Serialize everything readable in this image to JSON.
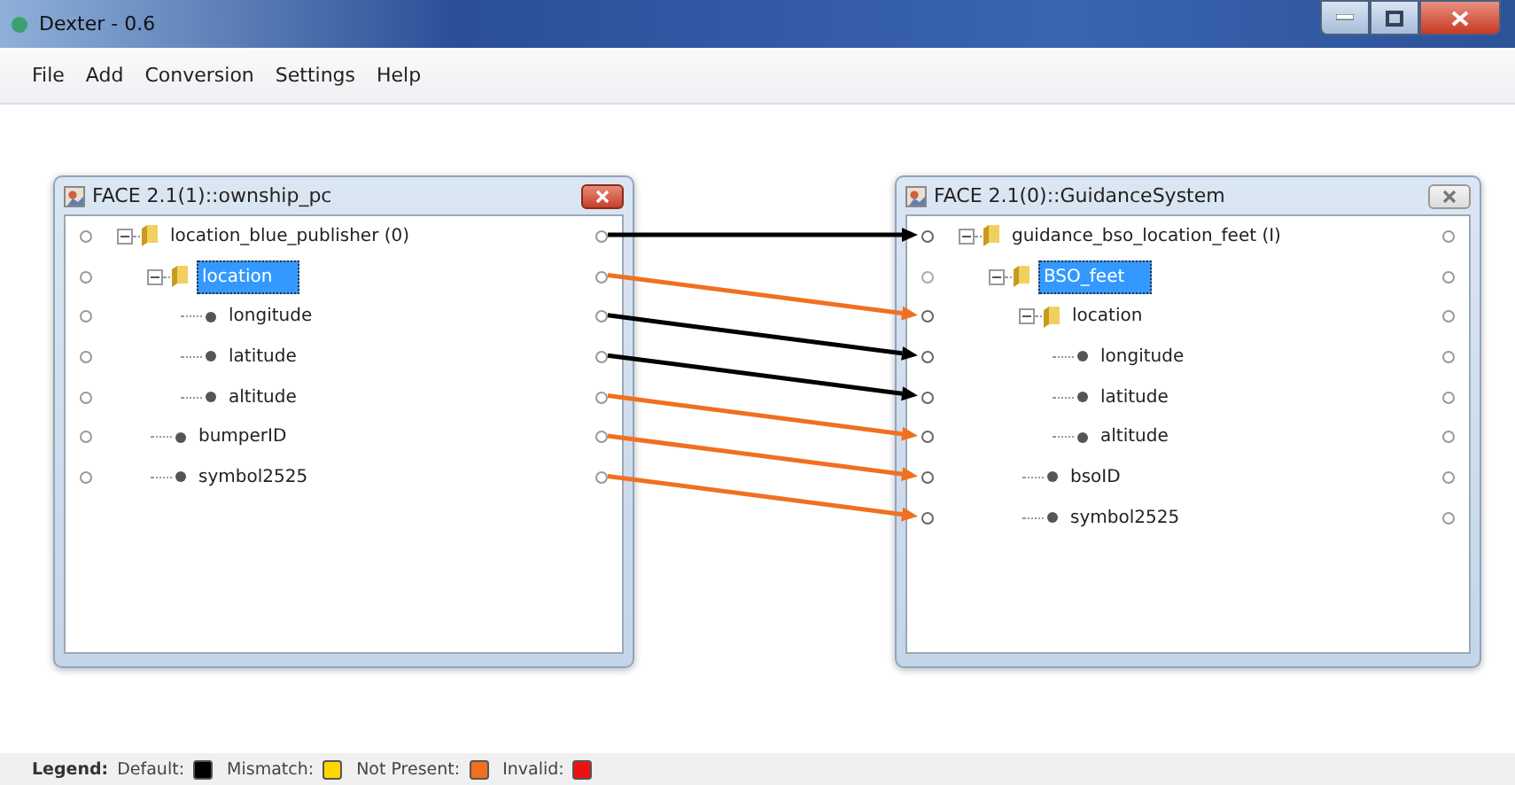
{
  "window": {
    "title": "Dexter - 0.6"
  },
  "menu": [
    "File",
    "Add",
    "Conversion",
    "Settings",
    "Help"
  ],
  "panels": [
    {
      "title": "FACE 2.1(1)::ownship_pc",
      "active": true,
      "tree": [
        {
          "label": "location_blue_publisher (0)",
          "kind": "folder",
          "selected": false,
          "color": "#000000",
          "children": [
            {
              "label": "location",
              "kind": "folder",
              "selected": true,
              "color": "#f07020",
              "children": [
                {
                  "label": "longitude",
                  "kind": "leaf",
                  "selected": false,
                  "color": "#000000"
                },
                {
                  "label": "latitude",
                  "kind": "leaf",
                  "selected": false,
                  "color": "#000000"
                },
                {
                  "label": "altitude",
                  "kind": "leaf",
                  "selected": false,
                  "color": "#f07020"
                }
              ]
            },
            {
              "label": "bumperID",
              "kind": "leaf",
              "selected": false,
              "color": "#f07020"
            },
            {
              "label": "symbol2525",
              "kind": "leaf",
              "selected": false,
              "color": "#f07020"
            }
          ]
        }
      ]
    },
    {
      "title": "FACE 2.1(0)::GuidanceSystem",
      "active": false,
      "tree": [
        {
          "label": "guidance_bso_location_feet (I)",
          "kind": "folder",
          "selected": false,
          "linked": true,
          "children": [
            {
              "label": "BSO_feet",
              "kind": "folder",
              "selected": true,
              "linked": false,
              "children": [
                {
                  "label": "location",
                  "kind": "folder",
                  "selected": false,
                  "linked": true,
                  "children": [
                    {
                      "label": "longitude",
                      "kind": "leaf",
                      "selected": false,
                      "linked": true
                    },
                    {
                      "label": "latitude",
                      "kind": "leaf",
                      "selected": false,
                      "linked": true
                    },
                    {
                      "label": "altitude",
                      "kind": "leaf",
                      "selected": false,
                      "linked": true
                    }
                  ]
                },
                {
                  "label": "bsoID",
                  "kind": "leaf",
                  "selected": false,
                  "linked": true
                },
                {
                  "label": "symbol2525",
                  "kind": "leaf",
                  "selected": false,
                  "linked": true
                }
              ]
            }
          ]
        }
      ]
    }
  ],
  "legend": {
    "title": "Legend:",
    "items": [
      {
        "label": "Default:",
        "color": "#000000"
      },
      {
        "label": "Mismatch:",
        "color": "#ffd700"
      },
      {
        "label": "Not Present:",
        "color": "#f07020"
      },
      {
        "label": "Invalid:",
        "color": "#ee1111"
      }
    ]
  }
}
